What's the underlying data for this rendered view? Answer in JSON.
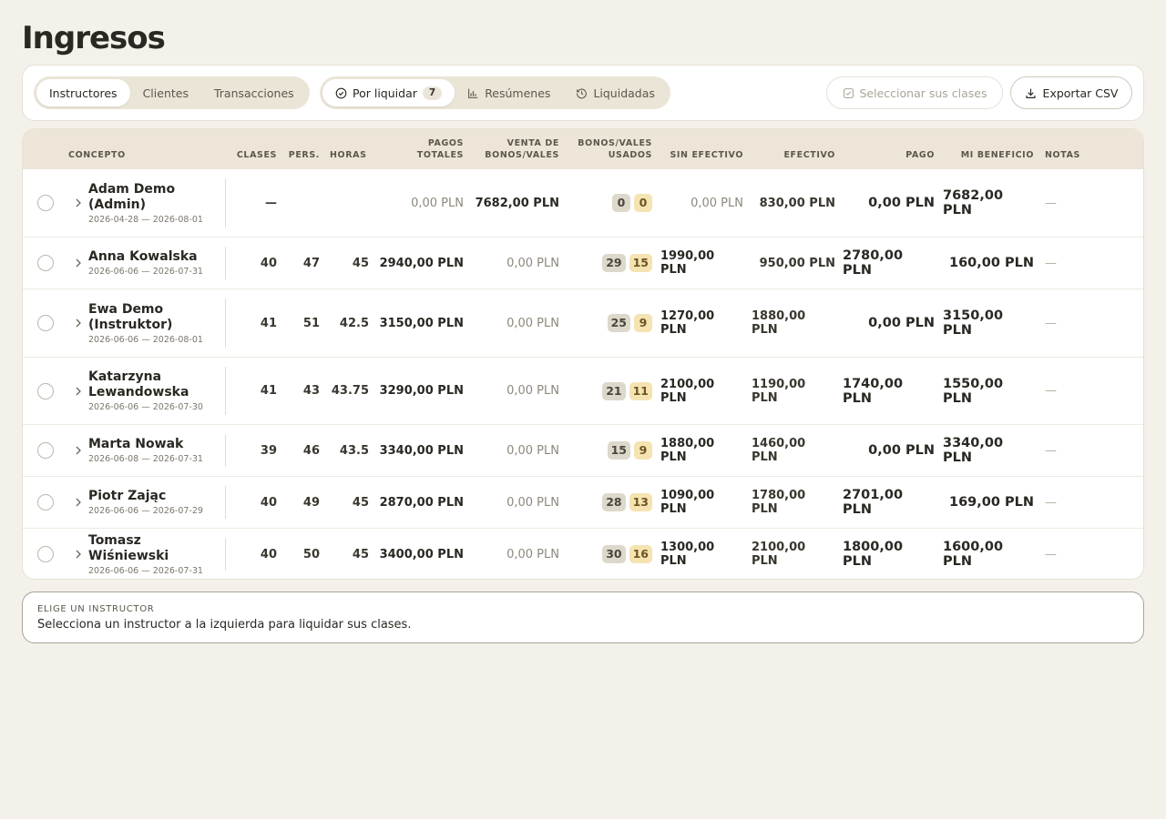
{
  "page_title": "Ingresos",
  "tabs": [
    {
      "label": "Instructores",
      "active": true
    },
    {
      "label": "Clientes",
      "active": false
    },
    {
      "label": "Transacciones",
      "active": false
    }
  ],
  "views": [
    {
      "label": "Por liquidar",
      "count": "7",
      "icon": "check-circle-icon",
      "active": true
    },
    {
      "label": "Resúmenes",
      "icon": "bar-chart-icon",
      "active": false
    },
    {
      "label": "Liquidadas",
      "icon": "history-icon",
      "active": false
    }
  ],
  "actions": {
    "select_label": "Seleccionar sus clases",
    "export_label": "Exportar CSV"
  },
  "columns": {
    "concept": "CONCEPTO",
    "classes": "CLASES",
    "pers": "PERS.",
    "hours": "HORAS",
    "total_payments": "PAGOS TOTALES",
    "voucher_sales": "VENTA DE BONOS/VALES",
    "vouchers_used": "BONOS/VALES USADOS",
    "non_cash": "SIN EFECTIVO",
    "cash": "EFECTIVO",
    "payment": "PAGO",
    "profit": "MI BENEFICIO",
    "notes": "NOTAS"
  },
  "rows": [
    {
      "name": "Adam Demo (Admin)",
      "dates": "2026-04-28 — 2026-08-01",
      "classes": "—",
      "pers": "",
      "hours": "",
      "total": "0,00 PLN",
      "voucher_sales": "7682,00 PLN",
      "used_a": "0",
      "used_b": "0",
      "non_cash": "0,00 PLN",
      "cash": "830,00 PLN",
      "payment": "0,00 PLN",
      "profit": "7682,00 PLN",
      "notes": "—"
    },
    {
      "name": "Anna Kowalska",
      "dates": "2026-06-06 — 2026-07-31",
      "classes": "40",
      "pers": "47",
      "hours": "45",
      "total": "2940,00 PLN",
      "voucher_sales": "0,00 PLN",
      "used_a": "29",
      "used_b": "15",
      "non_cash": "1990,00 PLN",
      "cash": "950,00 PLN",
      "payment": "2780,00 PLN",
      "profit": "160,00 PLN",
      "notes": "—"
    },
    {
      "name": "Ewa Demo (Instruktor)",
      "dates": "2026-06-06 — 2026-08-01",
      "classes": "41",
      "pers": "51",
      "hours": "42.5",
      "total": "3150,00 PLN",
      "voucher_sales": "0,00 PLN",
      "used_a": "25",
      "used_b": "9",
      "non_cash": "1270,00 PLN",
      "cash": "1880,00 PLN",
      "payment": "0,00 PLN",
      "profit": "3150,00 PLN",
      "notes": "—"
    },
    {
      "name": "Katarzyna Lewandowska",
      "dates": "2026-06-06 — 2026-07-30",
      "classes": "41",
      "pers": "43",
      "hours": "43.75",
      "total": "3290,00 PLN",
      "voucher_sales": "0,00 PLN",
      "used_a": "21",
      "used_b": "11",
      "non_cash": "2100,00 PLN",
      "cash": "1190,00 PLN",
      "payment": "1740,00 PLN",
      "profit": "1550,00 PLN",
      "notes": "—"
    },
    {
      "name": "Marta Nowak",
      "dates": "2026-06-08 — 2026-07-31",
      "classes": "39",
      "pers": "46",
      "hours": "43.5",
      "total": "3340,00 PLN",
      "voucher_sales": "0,00 PLN",
      "used_a": "15",
      "used_b": "9",
      "non_cash": "1880,00 PLN",
      "cash": "1460,00 PLN",
      "payment": "0,00 PLN",
      "profit": "3340,00 PLN",
      "notes": "—"
    },
    {
      "name": "Piotr Zając",
      "dates": "2026-06-06 — 2026-07-29",
      "classes": "40",
      "pers": "49",
      "hours": "45",
      "total": "2870,00 PLN",
      "voucher_sales": "0,00 PLN",
      "used_a": "28",
      "used_b": "13",
      "non_cash": "1090,00 PLN",
      "cash": "1780,00 PLN",
      "payment": "2701,00 PLN",
      "profit": "169,00 PLN",
      "notes": "—"
    },
    {
      "name": "Tomasz Wiśniewski",
      "dates": "2026-06-06 — 2026-07-31",
      "classes": "40",
      "pers": "50",
      "hours": "45",
      "total": "3400,00 PLN",
      "voucher_sales": "0,00 PLN",
      "used_a": "30",
      "used_b": "16",
      "non_cash": "1300,00 PLN",
      "cash": "2100,00 PLN",
      "payment": "1800,00 PLN",
      "profit": "1600,00 PLN",
      "notes": "—"
    }
  ],
  "footer": {
    "caption": "ELIGE UN INSTRUCTOR",
    "message": "Selecciona un instructor a la izquierda para liquidar sus clases."
  }
}
